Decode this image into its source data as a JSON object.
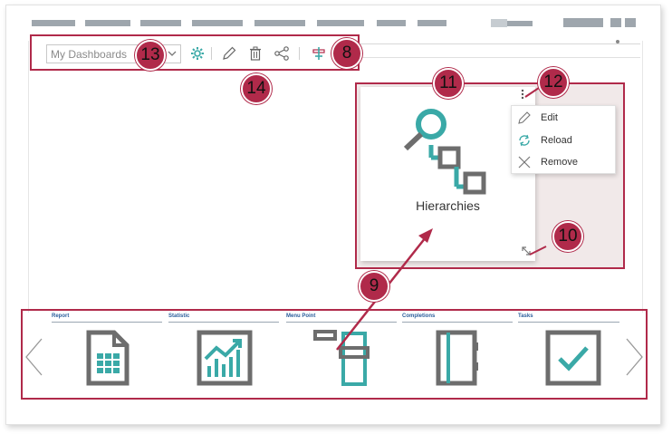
{
  "top_nav": {
    "bars": [
      "nav-1",
      "nav-2",
      "nav-3",
      "nav-4",
      "nav-5",
      "nav-6",
      "nav-7",
      "nav-8",
      "nav-9",
      "nav-10",
      "nav-11",
      "nav-12"
    ]
  },
  "toolbar": {
    "dashboard_select": {
      "value": "My Dashboards"
    },
    "icons": [
      "gear-icon",
      "pencil-icon",
      "trash-icon",
      "share-icon",
      "add-widget-icon"
    ]
  },
  "tile": {
    "label": "Hierarchies",
    "icon": "hierarchies-icon",
    "menu": [
      {
        "label": "Edit",
        "icon": "pencil-icon"
      },
      {
        "label": "Reload",
        "icon": "reload-icon"
      },
      {
        "label": "Remove",
        "icon": "close-icon"
      }
    ]
  },
  "widget_strip": {
    "items": [
      {
        "title": "Report",
        "icon": "report-icon"
      },
      {
        "title": "Statistic",
        "icon": "statistic-icon"
      },
      {
        "title": "Menu Point",
        "icon": "menu-point-icon"
      },
      {
        "title": "Completions",
        "icon": "completions-icon"
      },
      {
        "title": "Tasks",
        "icon": "tasks-icon"
      }
    ]
  },
  "callouts": {
    "c8": "8",
    "c9": "9",
    "c10": "10",
    "c11": "11",
    "c12": "12",
    "c13": "13",
    "c14": "14"
  },
  "colors": {
    "highlight": "#b02a4a",
    "teal": "#3aa9a7",
    "gray_icon": "#6d6d6d",
    "title_blue": "#2b5e9c"
  }
}
